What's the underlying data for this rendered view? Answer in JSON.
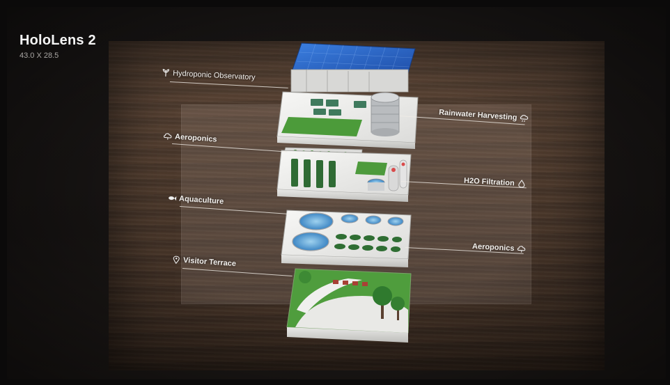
{
  "header": {
    "title": "HoloLens 2",
    "dimensions": "43.0 X 28.5"
  },
  "labels": {
    "hydroponic": "Hydroponic Observatory",
    "rainwater": "Rainwater Harvesting",
    "aeroponics_left": "Aeroponics",
    "h2o": "H2O Filtration",
    "aquaculture": "Aquaculture",
    "aeroponics_right": "Aeroponics",
    "visitor": "Visitor Terrace"
  },
  "colors": {
    "solar": "#2f6fd0",
    "building": "#eeeeec",
    "grass": "#4d9a3c",
    "water": "#5da8d8",
    "wood": "#4c3a2e"
  }
}
